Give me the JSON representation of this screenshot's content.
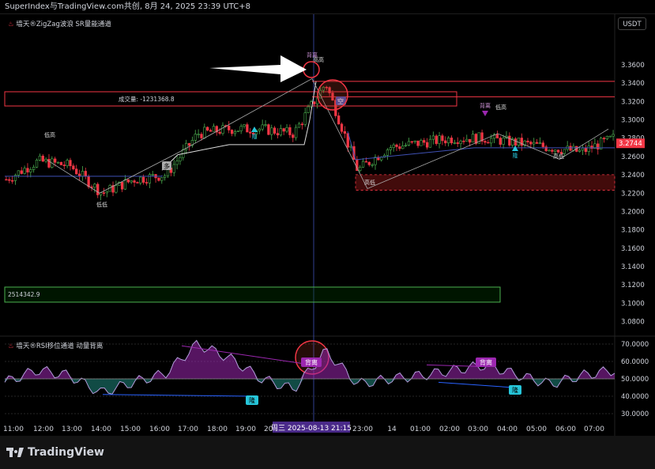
{
  "header": {
    "title": "SuperIndex与TradingView.com共创, 8月 24, 2025 23:39 UTC+8"
  },
  "indicators": {
    "main_label": "墙天®ZigZag波浪 SR量能通道",
    "sub_label": "墙天®RSI移位通道 动量背离"
  },
  "currency_button": "USDT",
  "price_axis": {
    "ticks": [
      "3.3600",
      "3.3400",
      "3.3200",
      "3.3000",
      "3.2800",
      "3.2600",
      "3.2400",
      "3.2200",
      "3.2000",
      "3.1800",
      "3.1600",
      "3.1400",
      "3.1200",
      "3.1000",
      "3.0800"
    ],
    "current_price": "3.2744"
  },
  "rsi_axis": {
    "ticks": [
      "70.0000",
      "60.0000",
      "50.0000",
      "40.0000",
      "30.0000"
    ]
  },
  "time_axis": {
    "ticks": [
      "11:00",
      "12:00",
      "13:00",
      "14:00",
      "15:00",
      "16:00",
      "17:00",
      "18:00",
      "19:00",
      "20:00",
      "23:00",
      "14",
      "01:00",
      "02:00",
      "03:00",
      "04:00",
      "05:00",
      "06:00",
      "07:00"
    ],
    "crosshair_label": "周三 2025-08-13 21:15"
  },
  "annotations": {
    "volume_box_label": "成交量: -1231368.8",
    "green_box_label": "2514342.9",
    "low_high_1": "低高",
    "low_low_1": "低低",
    "high_high": "高高",
    "high_low": "高低",
    "low_high_2": "低高",
    "high_low_2": "高低",
    "bear_div_main_1": "背离",
    "bear_div_main_2": "背离",
    "bull_div_main_1": "隆",
    "bull_div_main_2": "隆",
    "long_tag": "多",
    "short_tag": "空",
    "rsi_bear_1": "背离",
    "rsi_bear_2": "背离",
    "rsi_bull_1": "隆",
    "rsi_bull_2": "隆"
  },
  "branding": {
    "logo_text": "TradingView"
  },
  "colors": {
    "up": "#26a69a",
    "down": "#f23645",
    "up_outline": "#4caf50",
    "background": "#000000",
    "resistance": "#f23645",
    "support_line": "#3f51b5",
    "rsi_purple": "#9c27b0",
    "accent_blue": "#2962ff"
  },
  "chart_data": [
    {
      "type": "candlestick",
      "title": "",
      "ylim": [
        3.07,
        3.37
      ],
      "x": [
        "11:00",
        "12:00",
        "13:00",
        "14:00",
        "15:00",
        "16:00",
        "17:00",
        "18:00",
        "19:00",
        "20:00",
        "21:15",
        "23:00",
        "14",
        "01:00",
        "02:00",
        "03:00",
        "04:00",
        "05:00",
        "06:00",
        "07:00"
      ],
      "close": [
        3.235,
        3.255,
        3.25,
        3.22,
        3.235,
        3.24,
        3.285,
        3.29,
        3.29,
        3.285,
        3.34,
        3.245,
        3.27,
        3.275,
        3.28,
        3.28,
        3.275,
        3.27,
        3.265,
        3.28
      ],
      "resistance_zone": [
        3.3252,
        3.342
      ],
      "support_zone": [
        3.2232,
        3.2402
      ],
      "current_price": 3.2744
    },
    {
      "type": "line",
      "title": "",
      "ylim": [
        25,
        75
      ],
      "series": [
        {
          "values": [
            48,
            55,
            52,
            42,
            48,
            53,
            70,
            62,
            50,
            44,
            66,
            47,
            50,
            52,
            55,
            58,
            52,
            47,
            52,
            55
          ]
        }
      ]
    }
  ]
}
